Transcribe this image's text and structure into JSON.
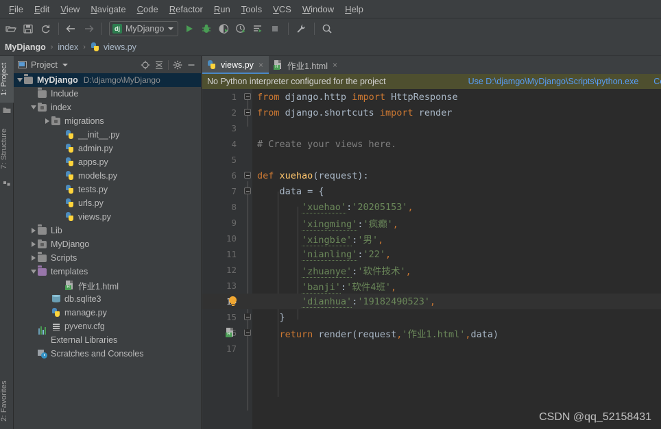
{
  "menu": {
    "items": [
      {
        "label": "File",
        "mnemonic": "F"
      },
      {
        "label": "Edit",
        "mnemonic": "E"
      },
      {
        "label": "View",
        "mnemonic": "V"
      },
      {
        "label": "Navigate",
        "mnemonic": "N"
      },
      {
        "label": "Code",
        "mnemonic": "C"
      },
      {
        "label": "Refactor",
        "mnemonic": "R"
      },
      {
        "label": "Run",
        "mnemonic": "R"
      },
      {
        "label": "Tools",
        "mnemonic": "T"
      },
      {
        "label": "VCS",
        "mnemonic": "V"
      },
      {
        "label": "Window",
        "mnemonic": "W"
      },
      {
        "label": "Help",
        "mnemonic": "H"
      }
    ]
  },
  "toolbar": {
    "icons": [
      "open-folder-icon",
      "save-all-icon",
      "sync-icon",
      "back-arrow-icon",
      "forward-arrow-icon"
    ],
    "run_config": {
      "badge": "dj",
      "label": "MyDjango"
    },
    "run_icons": [
      "run-icon",
      "debug-icon",
      "run-with-coverage-icon",
      "profile-icon",
      "run-tests-icon",
      "stop-icon"
    ],
    "right_icons": [
      "wrench-icon",
      "search-icon"
    ]
  },
  "breadcrumb": {
    "items": [
      "MyDjango",
      "index",
      "views.py"
    ],
    "separator": "›"
  },
  "left_strip": {
    "tabs": [
      {
        "label": "1: Project",
        "selected": true
      },
      {
        "label": "7: Structure",
        "selected": false
      },
      {
        "label": "2: Favorites",
        "selected": false
      }
    ]
  },
  "project_panel": {
    "title": "Project",
    "header_icons": [
      "locate-icon",
      "collapse-all-icon",
      "gear-icon",
      "hide-icon"
    ],
    "tree": [
      {
        "label": "MyDjango",
        "path": "D:\\djamgo\\MyDjango",
        "icon": "folder-icon",
        "arrow": "down",
        "depth": 0,
        "selected": true,
        "bold": true
      },
      {
        "label": "Include",
        "icon": "folder-icon",
        "arrow": "none",
        "depth": 1
      },
      {
        "label": "index",
        "icon": "folder-module-icon",
        "arrow": "down",
        "depth": 1
      },
      {
        "label": "migrations",
        "icon": "folder-module-icon",
        "arrow": "right",
        "depth": 2
      },
      {
        "label": "__init__.py",
        "icon": "python-file-icon",
        "arrow": "none",
        "depth": 3
      },
      {
        "label": "admin.py",
        "icon": "python-file-icon",
        "arrow": "none",
        "depth": 3
      },
      {
        "label": "apps.py",
        "icon": "python-file-icon",
        "arrow": "none",
        "depth": 3
      },
      {
        "label": "models.py",
        "icon": "python-file-icon",
        "arrow": "none",
        "depth": 3
      },
      {
        "label": "tests.py",
        "icon": "python-file-icon",
        "arrow": "none",
        "depth": 3
      },
      {
        "label": "urls.py",
        "icon": "python-file-icon",
        "arrow": "none",
        "depth": 3
      },
      {
        "label": "views.py",
        "icon": "python-file-icon",
        "arrow": "none",
        "depth": 3
      },
      {
        "label": "Lib",
        "icon": "folder-icon",
        "arrow": "right",
        "depth": 1
      },
      {
        "label": "MyDjango",
        "icon": "folder-module-icon",
        "arrow": "right",
        "depth": 1
      },
      {
        "label": "Scripts",
        "icon": "folder-icon",
        "arrow": "right",
        "depth": 1
      },
      {
        "label": "templates",
        "icon": "folder-purple-icon",
        "arrow": "down",
        "depth": 1
      },
      {
        "label": "作业1.html",
        "icon": "html-file-icon",
        "arrow": "none",
        "depth": 3
      },
      {
        "label": "db.sqlite3",
        "icon": "database-icon",
        "arrow": "none",
        "depth": 2
      },
      {
        "label": "manage.py",
        "icon": "python-file-icon",
        "arrow": "none",
        "depth": 2
      },
      {
        "label": "pyvenv.cfg",
        "icon": "config-file-icon",
        "arrow": "none",
        "depth": 2
      },
      {
        "label": "External Libraries",
        "icon": "libraries-icon",
        "arrow": "none",
        "depth": 1
      },
      {
        "label": "Scratches and Consoles",
        "icon": "scratches-icon",
        "arrow": "none",
        "depth": 1
      }
    ]
  },
  "editor": {
    "tabs": [
      {
        "label": "views.py",
        "icon": "python-file-icon",
        "active": true,
        "close": "×"
      },
      {
        "label": "作业1.html",
        "icon": "html-file-icon",
        "active": false,
        "close": "×"
      }
    ],
    "notification": {
      "message": "No Python interpreter configured for the project",
      "link_use": "Use D:\\djamgo\\MyDjango\\Scripts\\python.exe",
      "link_configure": "Config"
    },
    "highlighted_line": 14,
    "lines": [
      {
        "n": 1,
        "tokens": [
          {
            "t": "from",
            "c": "kw"
          },
          {
            "t": " django.http ",
            "c": "pun"
          },
          {
            "t": "import",
            "c": "kw"
          },
          {
            "t": " HttpResponse",
            "c": "pun"
          }
        ],
        "fold": "start"
      },
      {
        "n": 2,
        "tokens": [
          {
            "t": "from",
            "c": "kw"
          },
          {
            "t": " django.shortcuts ",
            "c": "pun"
          },
          {
            "t": "import",
            "c": "kw"
          },
          {
            "t": " render",
            "c": "pun"
          }
        ],
        "fold": "start"
      },
      {
        "n": 3,
        "tokens": []
      },
      {
        "n": 4,
        "tokens": [
          {
            "t": "# Create your views here.",
            "c": "cmt"
          }
        ]
      },
      {
        "n": 5,
        "tokens": []
      },
      {
        "n": 6,
        "tokens": [
          {
            "t": "def",
            "c": "kw"
          },
          {
            "t": " ",
            "c": "pun"
          },
          {
            "t": "xuehao",
            "c": "fn"
          },
          {
            "t": "(request):",
            "c": "pun"
          }
        ],
        "fold": "start"
      },
      {
        "n": 7,
        "tokens": [
          {
            "t": "    data = {",
            "c": "pun"
          }
        ],
        "fold": "start"
      },
      {
        "n": 8,
        "tokens": [
          {
            "t": "        ",
            "c": "pun"
          },
          {
            "t": "'xuehao'",
            "c": "str"
          },
          {
            "t": ":",
            "c": "pun"
          },
          {
            "t": "'20205153'",
            "c": "str"
          },
          {
            "t": ",",
            "c": "kw"
          }
        ]
      },
      {
        "n": 9,
        "tokens": [
          {
            "t": "        ",
            "c": "pun"
          },
          {
            "t": "'xingming'",
            "c": "str"
          },
          {
            "t": ":",
            "c": "pun"
          },
          {
            "t": "'疯癫'",
            "c": "str"
          },
          {
            "t": ",",
            "c": "kw"
          }
        ]
      },
      {
        "n": 10,
        "tokens": [
          {
            "t": "        ",
            "c": "pun"
          },
          {
            "t": "'xingbie'",
            "c": "str"
          },
          {
            "t": ":",
            "c": "pun"
          },
          {
            "t": "'男'",
            "c": "str"
          },
          {
            "t": ",",
            "c": "kw"
          }
        ]
      },
      {
        "n": 11,
        "tokens": [
          {
            "t": "        ",
            "c": "pun"
          },
          {
            "t": "'nianling'",
            "c": "str"
          },
          {
            "t": ":",
            "c": "pun"
          },
          {
            "t": "'22'",
            "c": "str"
          },
          {
            "t": ",",
            "c": "kw"
          }
        ]
      },
      {
        "n": 12,
        "tokens": [
          {
            "t": "        ",
            "c": "pun"
          },
          {
            "t": "'zhuanye'",
            "c": "str"
          },
          {
            "t": ":",
            "c": "pun"
          },
          {
            "t": "'软件技术'",
            "c": "str"
          },
          {
            "t": ",",
            "c": "kw"
          }
        ]
      },
      {
        "n": 13,
        "tokens": [
          {
            "t": "        ",
            "c": "pun"
          },
          {
            "t": "'banji'",
            "c": "str"
          },
          {
            "t": ":",
            "c": "pun"
          },
          {
            "t": "'软件4班'",
            "c": "str"
          },
          {
            "t": ",",
            "c": "kw"
          }
        ]
      },
      {
        "n": 14,
        "tokens": [
          {
            "t": "        ",
            "c": "pun"
          },
          {
            "t": "'dianhua'",
            "c": "str"
          },
          {
            "t": ":",
            "c": "pun"
          },
          {
            "t": "'19182490523'",
            "c": "str"
          },
          {
            "t": ",",
            "c": "kw"
          }
        ],
        "bulb": true
      },
      {
        "n": 15,
        "tokens": [
          {
            "t": "    }",
            "c": "pun"
          }
        ],
        "fold": "end"
      },
      {
        "n": 16,
        "tokens": [
          {
            "t": "    ",
            "c": "pun"
          },
          {
            "t": "return",
            "c": "kw"
          },
          {
            "t": " render(request",
            "c": "pun"
          },
          {
            "t": ",",
            "c": "kw"
          },
          {
            "t": "'作业1.html'",
            "c": "str"
          },
          {
            "t": ",",
            "c": "kw"
          },
          {
            "t": "data)",
            "c": "pun"
          }
        ],
        "fold": "end",
        "gutter_icon": "html-file-icon"
      },
      {
        "n": 17,
        "tokens": []
      }
    ]
  },
  "watermark": {
    "text": "CSDN @qq_52158431"
  },
  "colors": {
    "chrome": "#3c3f41",
    "editor_bg": "#2b2b2b",
    "gutter_bg": "#313335",
    "selection": "#0d293e",
    "notification_bg": "#4e4f2f",
    "link": "#589df6",
    "keyword": "#cc7832",
    "string": "#6a8759",
    "function": "#ffc66d",
    "comment": "#808080",
    "text": "#a9b7c6",
    "tab_underline": "#4a88c7"
  }
}
